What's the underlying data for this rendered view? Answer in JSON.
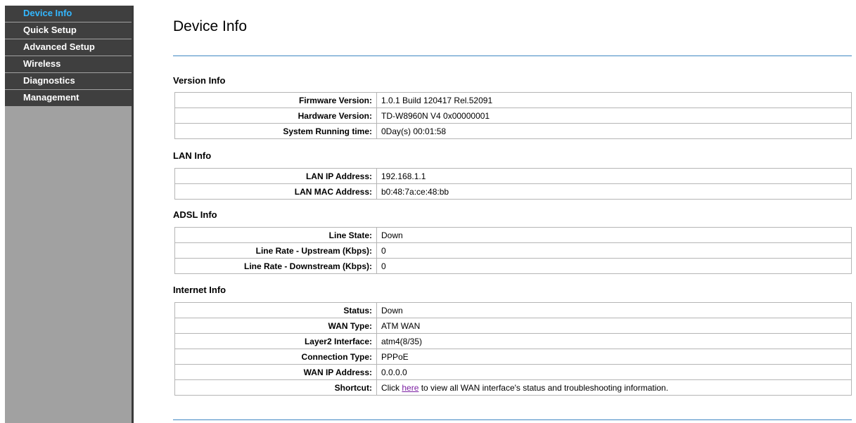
{
  "sidebar": {
    "items": [
      {
        "label": "Device Info",
        "active": true
      },
      {
        "label": "Quick Setup"
      },
      {
        "label": "Advanced Setup"
      },
      {
        "label": "Wireless"
      },
      {
        "label": "Diagnostics"
      },
      {
        "label": "Management"
      }
    ]
  },
  "page": {
    "title": "Device Info"
  },
  "version": {
    "title": "Version Info",
    "firmware_label": "Firmware Version:",
    "firmware_value": "1.0.1 Build 120417 Rel.52091",
    "hardware_label": "Hardware Version:",
    "hardware_value": "TD-W8960N V4 0x00000001",
    "runtime_label": "System Running time:",
    "runtime_value": "0Day(s) 00:01:58"
  },
  "lan": {
    "title": "LAN Info",
    "ip_label": "LAN IP Address:",
    "ip_value": "192.168.1.1",
    "mac_label": "LAN MAC Address:",
    "mac_value": "b0:48:7a:ce:48:bb"
  },
  "adsl": {
    "title": "ADSL Info",
    "state_label": "Line State:",
    "state_value": "Down",
    "up_label": "Line Rate - Upstream (Kbps):",
    "up_value": "0",
    "down_label": "Line Rate - Downstream (Kbps):",
    "down_value": "0"
  },
  "internet": {
    "title": "Internet Info",
    "status_label": "Status:",
    "status_value": "Down",
    "wantype_label": "WAN Type:",
    "wantype_value": "ATM WAN",
    "l2_label": "Layer2 Interface:",
    "l2_value": "atm4(8/35)",
    "conn_label": "Connection Type:",
    "conn_value": "PPPoE",
    "wanip_label": "WAN IP Address:",
    "wanip_value": "0.0.0.0",
    "shortcut_label": "Shortcut:",
    "shortcut_prefix": "Click ",
    "shortcut_link": "here",
    "shortcut_suffix": " to view all WAN interface's status and troubleshooting information."
  },
  "colors": {
    "accent_active": "#33b7ff",
    "divider": "#3e86c2",
    "status_down": "#ff3b3b",
    "nav_bg": "#3f3f3f",
    "sidebar_bg": "#a1a1a1"
  }
}
